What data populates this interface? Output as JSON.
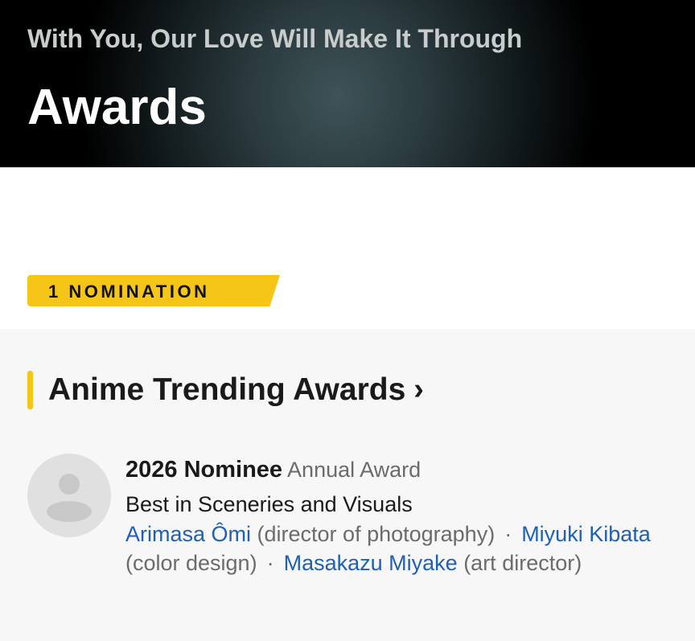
{
  "header": {
    "subtitle": "With You, Our Love Will Make It Through",
    "title": "Awards"
  },
  "summary": {
    "badge": "1 NOMINATION"
  },
  "section": {
    "title": "Anime Trending Awards",
    "chevron": "chevron-right-icon",
    "entries": [
      {
        "year_status": "2026 Nominee",
        "award_type": "Annual Award",
        "category": "Best in Sceneries and Visuals",
        "separator": "·",
        "people": [
          {
            "name": "Arimasa Ômi",
            "role": "(director of photography)"
          },
          {
            "name": "Miyuki Kibata",
            "role": "(color design)"
          },
          {
            "name": "Masakazu Miyake",
            "role": "(art director)"
          }
        ]
      }
    ]
  },
  "colors": {
    "accent": "#f5c518",
    "link": "#1f5fb4",
    "muted_text": "#6b6b6b",
    "section_bg": "#f7f7f7"
  }
}
